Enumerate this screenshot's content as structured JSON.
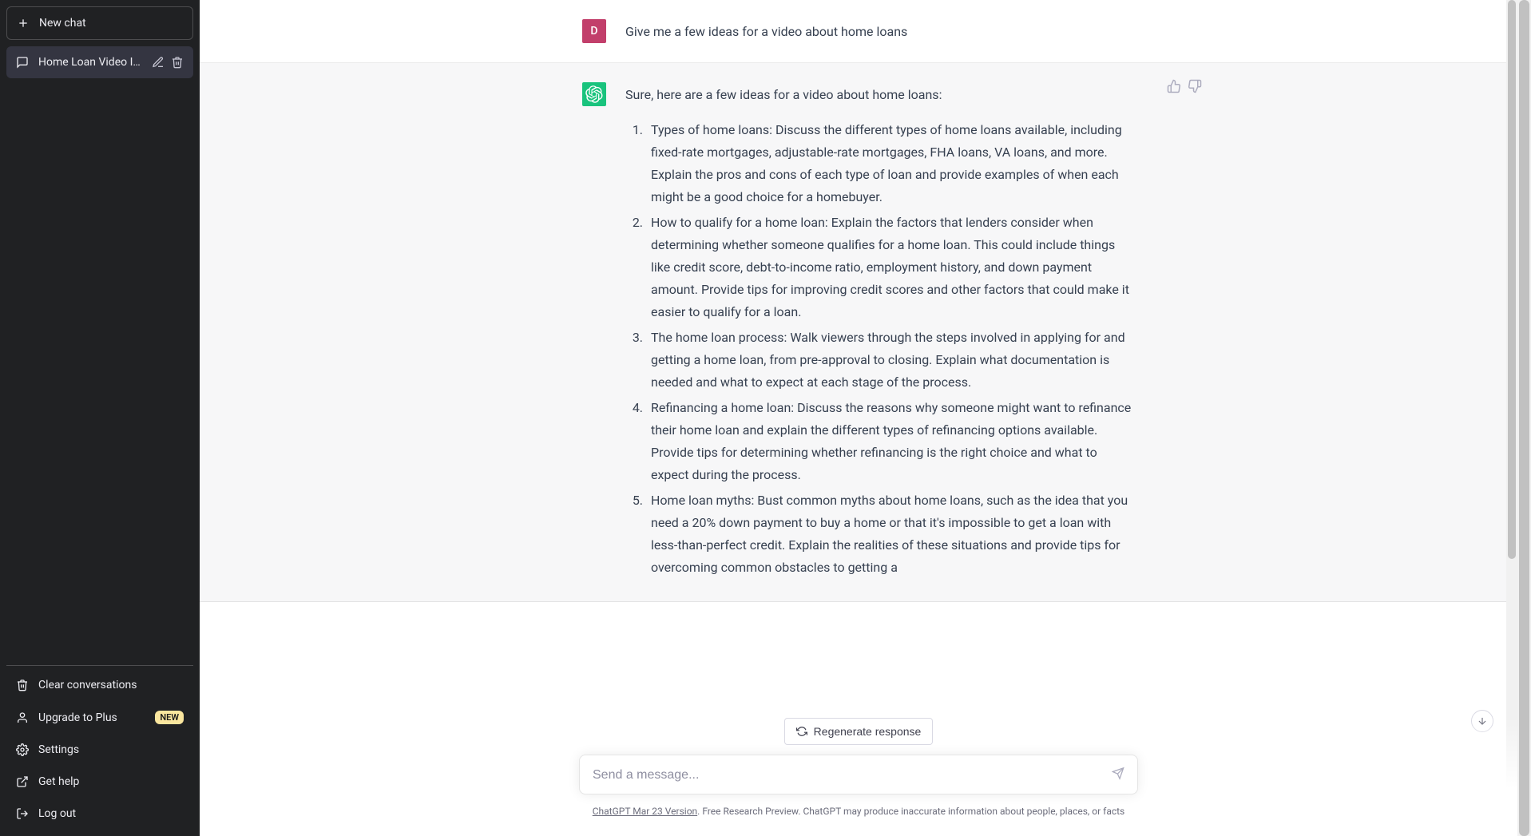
{
  "sidebar": {
    "new_chat_label": "New chat",
    "conversations": [
      {
        "title": "Home Loan Video Idea"
      }
    ],
    "footer": {
      "clear": "Clear conversations",
      "upgrade": "Upgrade to Plus",
      "upgrade_badge": "NEW",
      "settings": "Settings",
      "help": "Get help",
      "logout": "Log out"
    }
  },
  "chat": {
    "user": {
      "initial": "D",
      "prompt": "Give me a few ideas for a video about home loans"
    },
    "assistant": {
      "intro": "Sure, here are a few ideas for a video about home loans:",
      "items": [
        "Types of home loans: Discuss the different types of home loans available, including fixed-rate mortgages, adjustable-rate mortgages, FHA loans, VA loans, and more. Explain the pros and cons of each type of loan and provide examples of when each might be a good choice for a homebuyer.",
        "How to qualify for a home loan: Explain the factors that lenders consider when determining whether someone qualifies for a home loan. This could include things like credit score, debt-to-income ratio, employment history, and down payment amount. Provide tips for improving credit scores and other factors that could make it easier to qualify for a loan.",
        "The home loan process: Walk viewers through the steps involved in applying for and getting a home loan, from pre-approval to closing. Explain what documentation is needed and what to expect at each stage of the process.",
        "Refinancing a home loan: Discuss the reasons why someone might want to refinance their home loan and explain the different types of refinancing options available. Provide tips for determining whether refinancing is the right choice and what to expect during the process.",
        "Home loan myths: Bust common myths about home loans, such as the idea that you need a 20% down payment to buy a home or that it's impossible to get a loan with less-than-perfect credit. Explain the realities of these situations and provide tips for overcoming common obstacles to getting a"
      ]
    }
  },
  "controls": {
    "regenerate": "Regenerate response",
    "input_placeholder": "Send a message...",
    "disclaimer_link": "ChatGPT Mar 23 Version",
    "disclaimer_rest": ". Free Research Preview. ChatGPT may produce inaccurate information about people, places, or facts"
  }
}
